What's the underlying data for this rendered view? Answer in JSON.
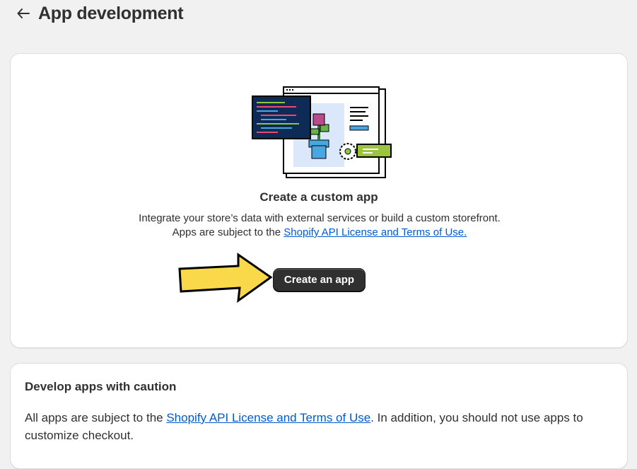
{
  "header": {
    "back_icon": "arrow-left-icon",
    "title": "App development"
  },
  "main_card": {
    "illustration": "custom-app-illustration",
    "title": "Create a custom app",
    "description_part1": "Integrate your store’s data with external services or build a custom storefront. Apps are subject to the ",
    "description_link": "Shopify API License and Terms of Use.",
    "create_button_label": "Create an app",
    "annotation_arrow_color": "#f9d949"
  },
  "caution_card": {
    "title": "Develop apps with caution",
    "body_part1": "All apps are subject to the ",
    "body_link": "Shopify API License and Terms of Use",
    "body_part2": ". In addition, you should not use apps to customize checkout."
  },
  "colors": {
    "link": "#005bd3",
    "button_bg": "#303030",
    "page_bg": "#f1f1f1"
  }
}
